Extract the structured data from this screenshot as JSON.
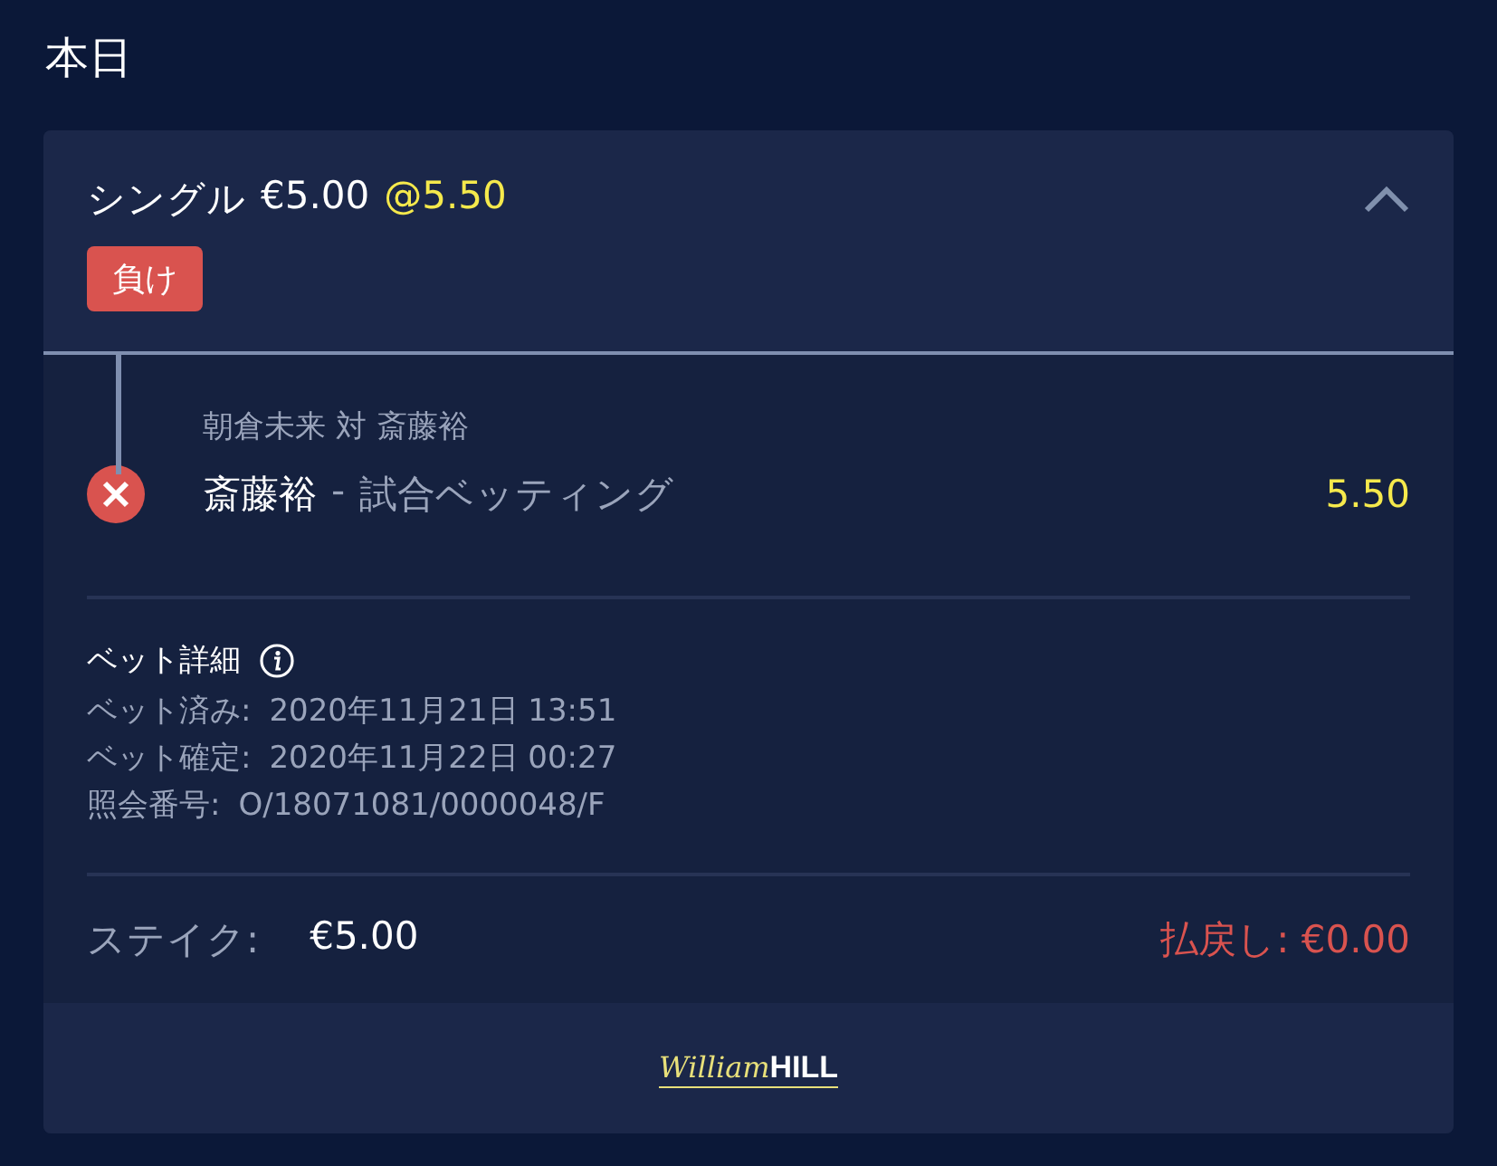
{
  "section_title": "本日",
  "bet": {
    "type_label": "シングル",
    "stake": "€5.00",
    "odds": "@5.50",
    "expanded": true,
    "result": {
      "kind": "lost",
      "label": "負け"
    },
    "selection": {
      "event": "朝倉未来 対 斎藤裕",
      "pick": "斎藤裕",
      "separator": "-",
      "market": "試合ベッティング",
      "odds": "5.50",
      "kind": "lost"
    },
    "details": {
      "title": "ベット詳細",
      "rows": [
        {
          "label": "ベット済み:",
          "value": "2020年11月21日 13:51"
        },
        {
          "label": "ベット確定:",
          "value": "2020年11月22日 00:27"
        },
        {
          "label": "照会番号:",
          "value": "O/18071081/0000048/F"
        }
      ]
    },
    "stake_label": "ステイク:",
    "stake_value": "€5.00",
    "returns": "払戻し: €0.00"
  },
  "footer": {
    "logo_script": "William",
    "logo_bold": "HILL"
  }
}
